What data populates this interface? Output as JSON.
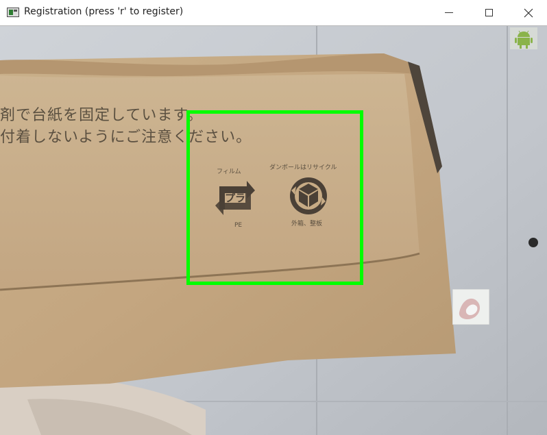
{
  "window": {
    "title": "Registration (press 'r' to register)",
    "controls": {
      "minimize": "minimize",
      "maximize": "maximize",
      "close": "close"
    }
  },
  "camera_view": {
    "box_text": {
      "line1": "剤で台紙を固定しています。",
      "line2": "付着しないようにご注意ください。",
      "film_label": "フィルム",
      "pla_mark": "プラ",
      "pe_label": "PE",
      "cardboard_label": "ダンボールはリサイクル",
      "outer_box_label": "外箱、整板"
    },
    "detection_box_color": "#00ff00",
    "icons": [
      "android-icon",
      "sticker"
    ]
  }
}
